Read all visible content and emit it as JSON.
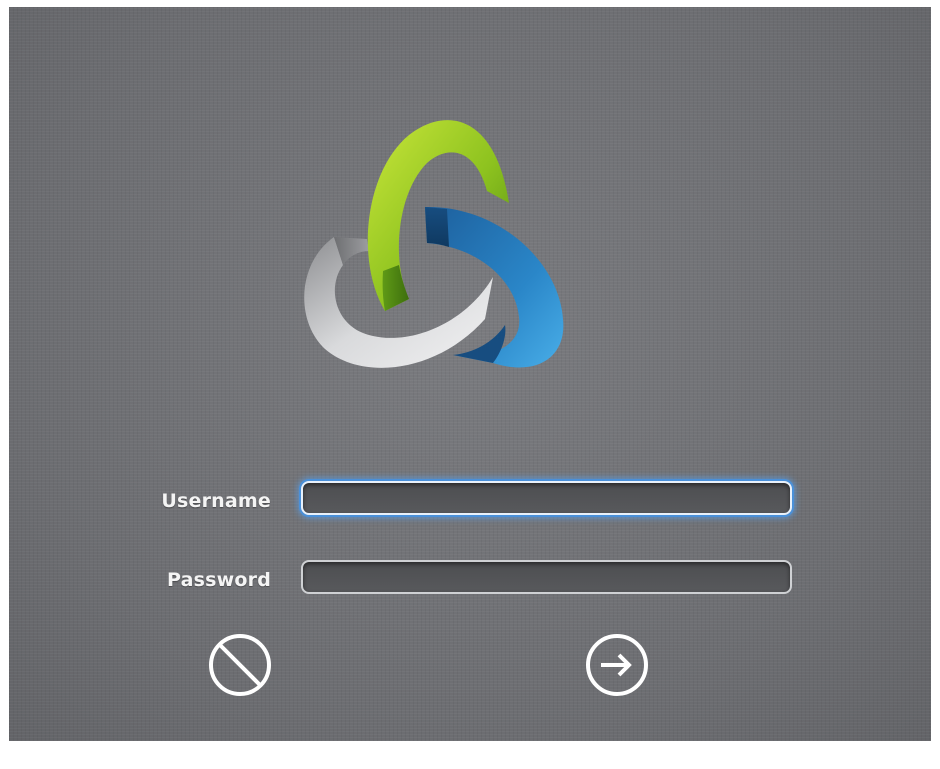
{
  "login": {
    "username_label": "Username",
    "password_label": "Password",
    "username_value": "",
    "password_value": ""
  },
  "logo": {
    "icon": "tri-swirl-logo",
    "colors": {
      "green": "#8dc21f",
      "blue": "#2a86c8",
      "gray": "#c7c8ca"
    }
  },
  "actions": {
    "cancel_icon": "prohibited-icon",
    "submit_icon": "arrow-right-circle-icon"
  },
  "theme": {
    "background": "#6f7074",
    "focus_ring": "#4a90d9",
    "text": "#f4f4f4"
  }
}
